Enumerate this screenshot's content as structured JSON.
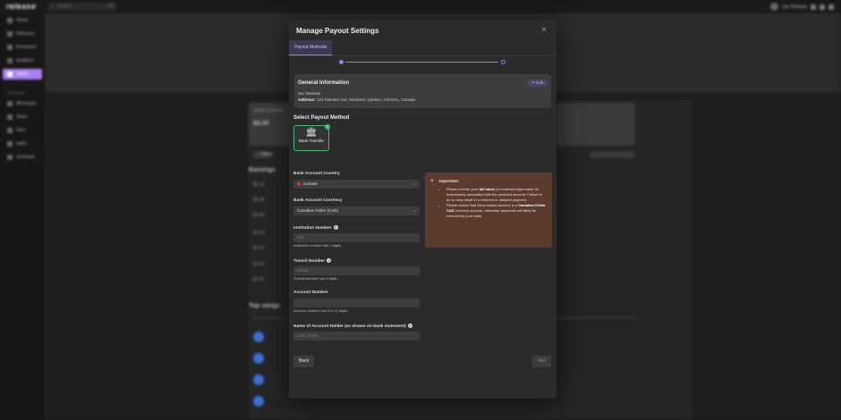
{
  "app": {
    "logo": "release"
  },
  "topbar": {
    "search_placeholder": "Search",
    "search_shortcut": "⌘K",
    "user_name": "Zac Release"
  },
  "sidebar": {
    "items": [
      {
        "label": "Home"
      },
      {
        "label": "Releases"
      },
      {
        "label": "Promotion"
      },
      {
        "label": "Analytics"
      },
      {
        "label": "Wallet"
      }
    ],
    "section": "Workspace",
    "items2": [
      {
        "label": "Messages"
      },
      {
        "label": "Tasks"
      },
      {
        "label": "Files"
      },
      {
        "label": "Splits"
      },
      {
        "label": "Schedule"
      }
    ]
  },
  "background": {
    "balance_label": "Wallet Balance",
    "balance_value": "$0.00",
    "filter_label": "Filters",
    "earnings_title": "Earnings",
    "top_songs_title": "Top songs",
    "y_ticks": [
      "$0.10",
      "$0.08",
      "$0.06",
      "$0.04",
      "$0.02",
      "$0.00",
      "$0.00"
    ]
  },
  "modal": {
    "title": "Manage Payout Settings",
    "tab": "Payout Methods",
    "general": {
      "heading": "General Information",
      "edit": "Edit",
      "name": "Zac Release",
      "address_label": "Address:",
      "address": "123 Release Ave, Montreal, Quebec, H1H1H1, Canada"
    },
    "select_method": "Select Payout Method",
    "method": "Bank Transfer",
    "country_label": "Bank Account Country",
    "country_value": "Canada",
    "currency_label": "Bank Account Currency",
    "currency_value": "Canadian Dollar (CAD)",
    "institution_label": "Institution Number",
    "institution_placeholder": "123",
    "institution_hint": "Institution number has 3 digits",
    "transit_label": "Transit Number",
    "transit_placeholder": "12345",
    "transit_hint": "Transit Number has 5 digits",
    "account_label": "Account Number",
    "account_placeholder": "",
    "account_hint": "Account number has 5 to 12 digits",
    "holder_label": "Name of Account Holder (as shown on bank statement)",
    "holder_placeholder": "John Smith",
    "important": {
      "heading": "Important:",
      "bullet1_pre": "Please provide your ",
      "bullet1_bold": "full name",
      "bullet1_post": " (or business legal name for businesses) associated with the provided account. Failure to do so may result in a returned or delayed payment.",
      "bullet2_pre": "Please ensure that the provided account is a ",
      "bullet2_bold": "Canadian Dollar CAD",
      "bullet2_post": " currency account, otherwise payments will likely be returned by your bank."
    },
    "back": "Back",
    "add": "Add"
  }
}
